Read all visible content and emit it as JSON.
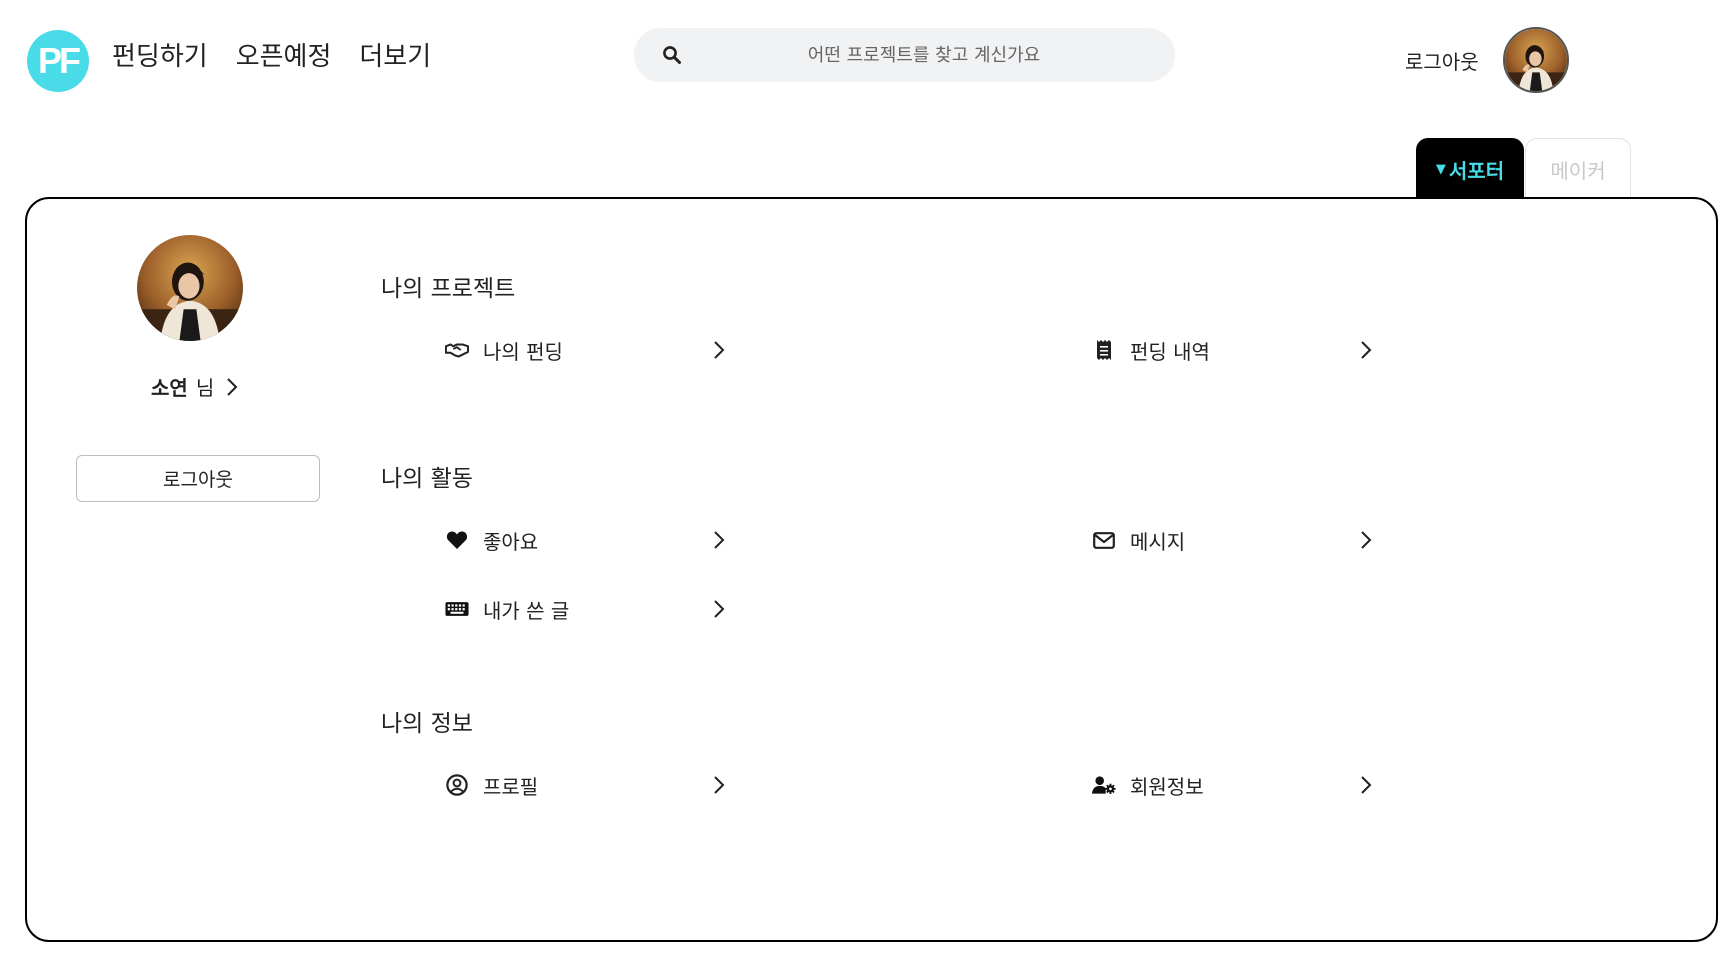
{
  "brand": {
    "logo_text": "PF",
    "logo_color": "#49dbe8"
  },
  "nav": {
    "items": [
      "펀딩하기",
      "오픈예정",
      "더보기"
    ]
  },
  "search": {
    "placeholder": "어떤 프로젝트를 찾고 계신가요"
  },
  "header": {
    "logout_label": "로그아웃"
  },
  "role_tabs": {
    "supporter_label": "서포터",
    "maker_label": "메이커",
    "active": "서포터",
    "accent": "#49dbe8"
  },
  "profile": {
    "name": "소연",
    "suffix": "님",
    "logout_button": "로그아웃"
  },
  "sections": {
    "projects": {
      "title": "나의 프로젝트",
      "items": [
        {
          "label": "나의 펀딩",
          "icon": "handshake-icon"
        },
        {
          "label": "펀딩 내역",
          "icon": "receipt-icon"
        }
      ]
    },
    "activity": {
      "title": "나의 활동",
      "items": [
        {
          "label": "좋아요",
          "icon": "heart-icon"
        },
        {
          "label": "메시지",
          "icon": "envelope-icon"
        },
        {
          "label": "내가 쓴 글",
          "icon": "keyboard-icon"
        }
      ]
    },
    "info": {
      "title": "나의 정보",
      "items": [
        {
          "label": "프로필",
          "icon": "user-circle-icon"
        },
        {
          "label": "회원정보",
          "icon": "user-gear-icon"
        }
      ]
    }
  }
}
